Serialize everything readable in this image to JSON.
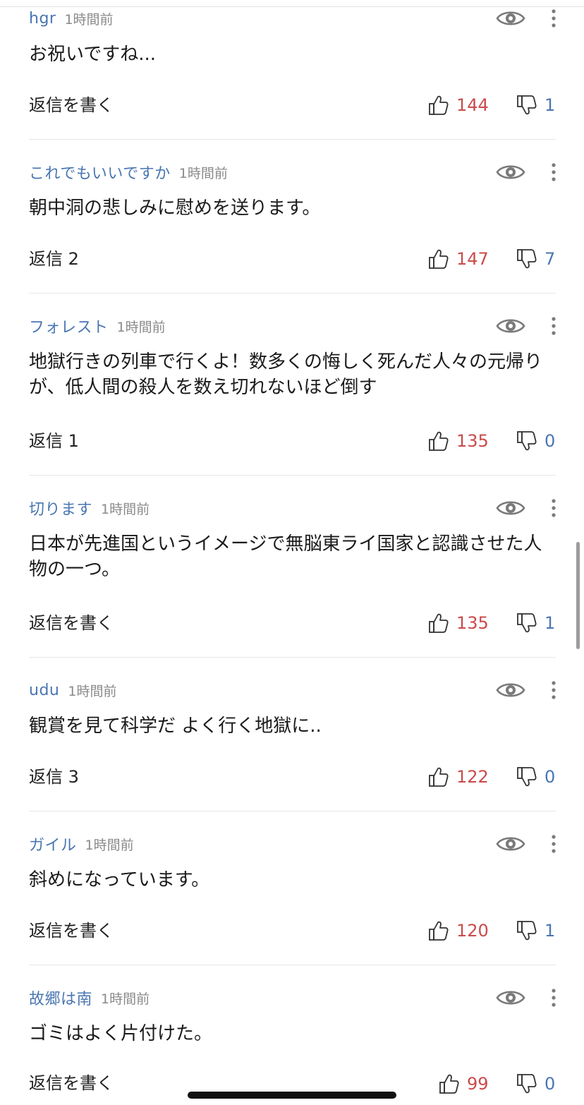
{
  "comments": [
    {
      "username": "hgr",
      "time": "1時間前",
      "body": "お祝いですね...",
      "reply": "返信を書く",
      "likes": "144",
      "dislikes": "1"
    },
    {
      "username": "これでもいいですか",
      "time": "1時間前",
      "body": "朝中洞の悲しみに慰めを送ります。",
      "reply": "返信 2",
      "likes": "147",
      "dislikes": "7"
    },
    {
      "username": "フォレスト",
      "time": "1時間前",
      "body": "地獄行きの列車で行くよ！数多くの悔しく死んだ人々の元帰りが、低人間の殺人を数え切れないほど倒す",
      "reply": "返信 1",
      "likes": "135",
      "dislikes": "0"
    },
    {
      "username": "切ります",
      "time": "1時間前",
      "body": "日本が先進国というイメージで無脳東ライ国家と認識させた人物の一つ。",
      "reply": "返信を書く",
      "likes": "135",
      "dislikes": "1"
    },
    {
      "username": "udu",
      "time": "1時間前",
      "body": "観賞を見て科学だ よく行く地獄に..",
      "reply": "返信 3",
      "likes": "122",
      "dislikes": "0"
    },
    {
      "username": "ガイル",
      "time": "1時間前",
      "body": "斜めになっています。",
      "reply": "返信を書く",
      "likes": "120",
      "dislikes": "1"
    },
    {
      "username": "故郷は南",
      "time": "1時間前",
      "body": "ゴミはよく片付けた。",
      "reply": "返信を書く",
      "likes": "99",
      "dislikes": "0"
    }
  ],
  "colors": {
    "username": "#4a76b2",
    "timestamp": "#8a8a8a",
    "like_count": "#cc4a4a",
    "dislike_count": "#4a76b2",
    "icon_gray": "#7a7a7a"
  },
  "icons": {
    "eye": "eye-icon",
    "more": "more-vertical-icon",
    "like": "thumbs-up-icon",
    "dislike": "thumbs-down-icon"
  }
}
